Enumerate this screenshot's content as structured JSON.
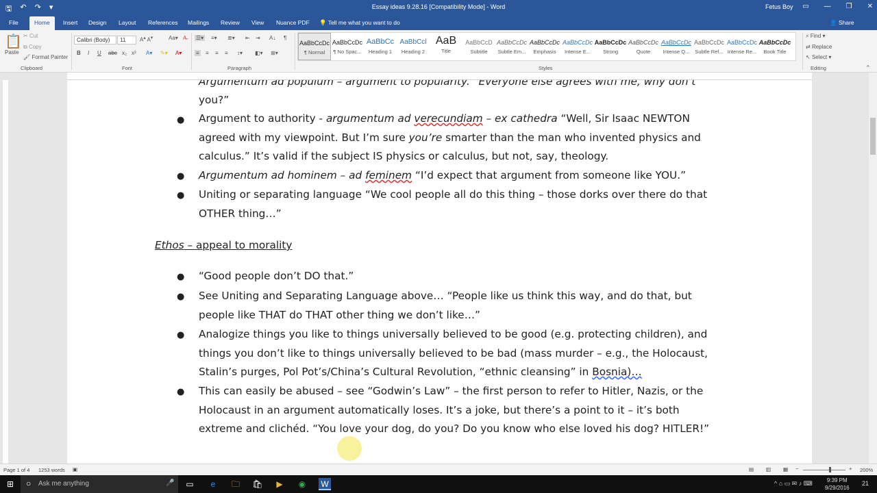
{
  "window": {
    "title": "Essay ideas 9.28.16 [Compatibility Mode] - Word",
    "user": "Fetus Boy"
  },
  "tabs": [
    "File",
    "Home",
    "Insert",
    "Design",
    "Layout",
    "References",
    "Mailings",
    "Review",
    "View",
    "Nuance PDF"
  ],
  "tell_me": "Tell me what you want to do",
  "share": "Share",
  "clipboard": {
    "paste": "Paste",
    "cut": "Cut",
    "copy": "Copy",
    "format_painter": "Format Painter",
    "label": "Clipboard"
  },
  "font": {
    "name": "Calibri (Body)",
    "size": "11",
    "label": "Font"
  },
  "paragraph": {
    "label": "Paragraph"
  },
  "styles": {
    "label": "Styles",
    "items": [
      {
        "preview": "AaBbCcDc",
        "name": "¶ Normal"
      },
      {
        "preview": "AaBbCcDc",
        "name": "¶ No Spac..."
      },
      {
        "preview": "AaBbCc",
        "name": "Heading 1"
      },
      {
        "preview": "AaBbCcl",
        "name": "Heading 2"
      },
      {
        "preview": "AaB",
        "name": "Title"
      },
      {
        "preview": "AaBbCcD",
        "name": "Subtitle"
      },
      {
        "preview": "AaBbCcDc",
        "name": "Subtle Em..."
      },
      {
        "preview": "AaBbCcDc",
        "name": "Emphasis"
      },
      {
        "preview": "AaBbCcDc",
        "name": "Intense E..."
      },
      {
        "preview": "AaBbCcDc",
        "name": "Strong"
      },
      {
        "preview": "AaBbCcDc",
        "name": "Quote"
      },
      {
        "preview": "AaBbCcDc",
        "name": "Intense Q..."
      },
      {
        "preview": "AaBbCcDc",
        "name": "Subtle Ref..."
      },
      {
        "preview": "AaBbCcDc",
        "name": "Intense Re..."
      },
      {
        "preview": "AaBbCcDc",
        "name": "Book Title"
      }
    ]
  },
  "editing": {
    "find": "Find",
    "replace": "Replace",
    "select": "Select",
    "label": "Editing"
  },
  "document": {
    "top_frag": "Argumentum ad populum – argument to popularity. “Everyone else agrees with me, why don’t",
    "top_frag2": "you?”",
    "heading_ethos": "Ethos",
    "heading_rest": " – appeal to morality",
    "bullets": {
      "b1a": "Argument to authority - ",
      "b1b": "argumentum ad ",
      "b1c": "verecundiam",
      "b1d": " – ex cathedra",
      "b1e": " “Well, Sir Isaac NEWTON agreed with my viewpoint. But I’m sure ",
      "b1f": "you’re",
      "b1g": " smarter than the man who invented physics and calculus.” It’s valid if the subject IS physics or calculus, but not, say, theology.",
      "b2a": "Argumentum ad hominem – ad ",
      "b2b": "feminem",
      "b2c": " “I’d expect that argument from someone like YOU.”",
      "b3": "Uniting or separating language “We cool people all do this thing – those dorks over there do that OTHER thing…”",
      "b4": "“Good people don’t DO that.”",
      "b5": "See Uniting and Separating Language above… “People like us think this way, and do that, but people like THAT do THAT other thing we don’t like…”",
      "b6a": "Analogize things you like to things universally believed to be good (e.g. protecting children), and things you don’t like to things universally believed to be bad (mass murder – e.g., the Holocaust, Stalin’s purges, Pol Pot’s/China’s Cultural Revolution, “ethnic cleansing” in ",
      "b6b": "Bosnia)…",
      "b7": "This can easily be abused – see “Godwin’s Law” – the first person to refer to Hitler, Nazis, or the Holocaust in an argument automatically loses. It’s a joke, but there’s a point to it – it’s both extreme and clichéd. “You love your dog, do you? Do you know who else loved his dog? HITLER!”"
    }
  },
  "status": {
    "page": "Page 1 of 4",
    "words": "1253 words",
    "zoom": "200%"
  },
  "taskbar": {
    "search": "Ask me anything",
    "time": "9:39 PM",
    "date": "9/29/2016",
    "notif": "21"
  },
  "colors": {
    "accent": "#2b579a"
  }
}
